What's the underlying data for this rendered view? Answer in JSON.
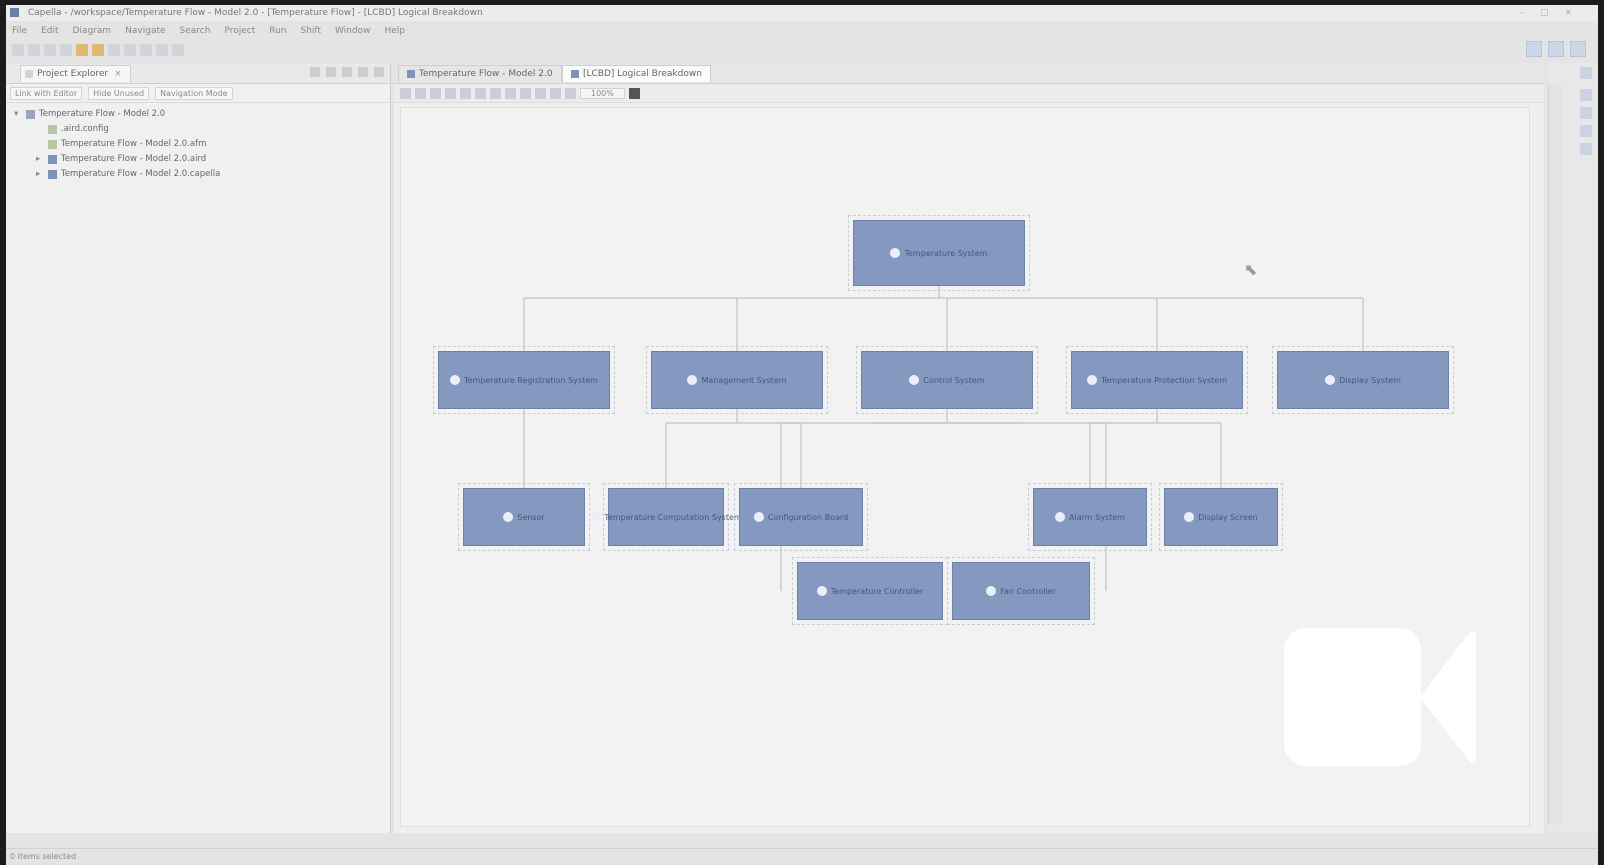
{
  "window": {
    "title": "Capella - /workspace/Temperature Flow - Model 2.0 - [Temperature Flow] - [LCBD] Logical Breakdown"
  },
  "menubar": {
    "items": [
      "File",
      "Edit",
      "Diagram",
      "Navigate",
      "Search",
      "Project",
      "Run",
      "Shift",
      "Window",
      "Help"
    ]
  },
  "project_explorer": {
    "tab_label": "Project Explorer",
    "close": "×",
    "nav": [
      "Link with Editor",
      "Hide Unused",
      "Navigation Mode"
    ],
    "tree": [
      {
        "label": "Temperature Flow - Model 2.0",
        "level": 0,
        "twisty": "▾",
        "icon": "project"
      },
      {
        "label": ".aird.config",
        "level": 1,
        "twisty": "",
        "icon": "file"
      },
      {
        "label": "Temperature Flow - Model 2.0.afm",
        "level": 1,
        "twisty": "",
        "icon": "file"
      },
      {
        "label": "Temperature Flow - Model 2.0.aird",
        "level": 1,
        "twisty": "▸",
        "icon": "diag"
      },
      {
        "label": "Temperature Flow - Model 2.0.capella",
        "level": 1,
        "twisty": "▸",
        "icon": "diag"
      }
    ]
  },
  "editor": {
    "tabs": [
      {
        "label": "Temperature Flow - Model 2.0",
        "active": false
      },
      {
        "label": "[LCBD] Logical Breakdown",
        "active": true
      }
    ],
    "zoom": "100%"
  },
  "diagram": {
    "blocks": [
      {
        "id": "root",
        "label": "Temperature System"
      },
      {
        "id": "b1",
        "label": "Temperature Registration System"
      },
      {
        "id": "b2",
        "label": "Management System"
      },
      {
        "id": "b3",
        "label": "Control System"
      },
      {
        "id": "b4",
        "label": "Temperature Protection System"
      },
      {
        "id": "b5",
        "label": "Display System"
      },
      {
        "id": "c1",
        "label": "Sensor"
      },
      {
        "id": "c2",
        "label": "Temperature Computation System"
      },
      {
        "id": "c3",
        "label": "Configuration Board"
      },
      {
        "id": "c4",
        "label": "Alarm System"
      },
      {
        "id": "c5",
        "label": "Display Screen"
      },
      {
        "id": "d1",
        "label": "Temperature Controller"
      },
      {
        "id": "d2",
        "label": "Fan Controller"
      }
    ]
  },
  "statusbar": {
    "text": "0 items selected"
  },
  "colors": {
    "block_fill": "#8599c0",
    "block_border": "#6c80a8",
    "connector": "#c2c2c2",
    "background": "#1c1c1c",
    "video_icon": "#ffffff"
  },
  "overlay": {
    "icon": "video-camera-icon"
  }
}
